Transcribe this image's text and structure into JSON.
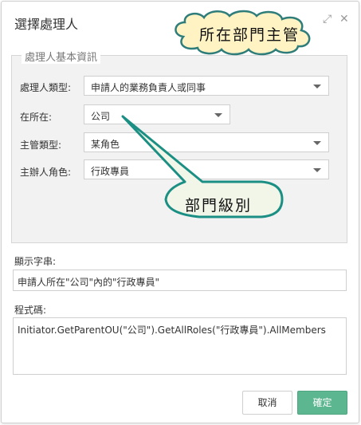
{
  "dialog": {
    "title": "選擇處理人",
    "expand_glyph": "⤢",
    "close_glyph": "✕"
  },
  "group": {
    "legend": "處理人基本資訊",
    "rows": [
      {
        "label": "處理人類型:",
        "value": "申請人的業務負責人或同事"
      },
      {
        "label": "在所在:",
        "value": "公司"
      },
      {
        "label": "主管類型:",
        "value": "某角色"
      },
      {
        "label": "主辦人角色:",
        "value": "行政專員"
      }
    ]
  },
  "display_string": {
    "label": "顯示字串:",
    "value": "申請人所在\"公司\"內的\"行政專員\""
  },
  "program_code": {
    "label": "程式碼:",
    "value": "Initiator.GetParentOU(\"公司\").GetAllRoles(\"行政專員\").AllMembers"
  },
  "buttons": {
    "cancel": "取消",
    "ok": "確定"
  },
  "callouts": {
    "cloud": "所在部門主管",
    "bubble": "部門級別"
  },
  "colors": {
    "primary_button": "#5cb68f",
    "cloud_fill": "#fff3c4",
    "cloud_stroke": "#2f7d7a",
    "bubble_fill": "#f1f6e9",
    "bubble_stroke": "#1b8f84"
  }
}
